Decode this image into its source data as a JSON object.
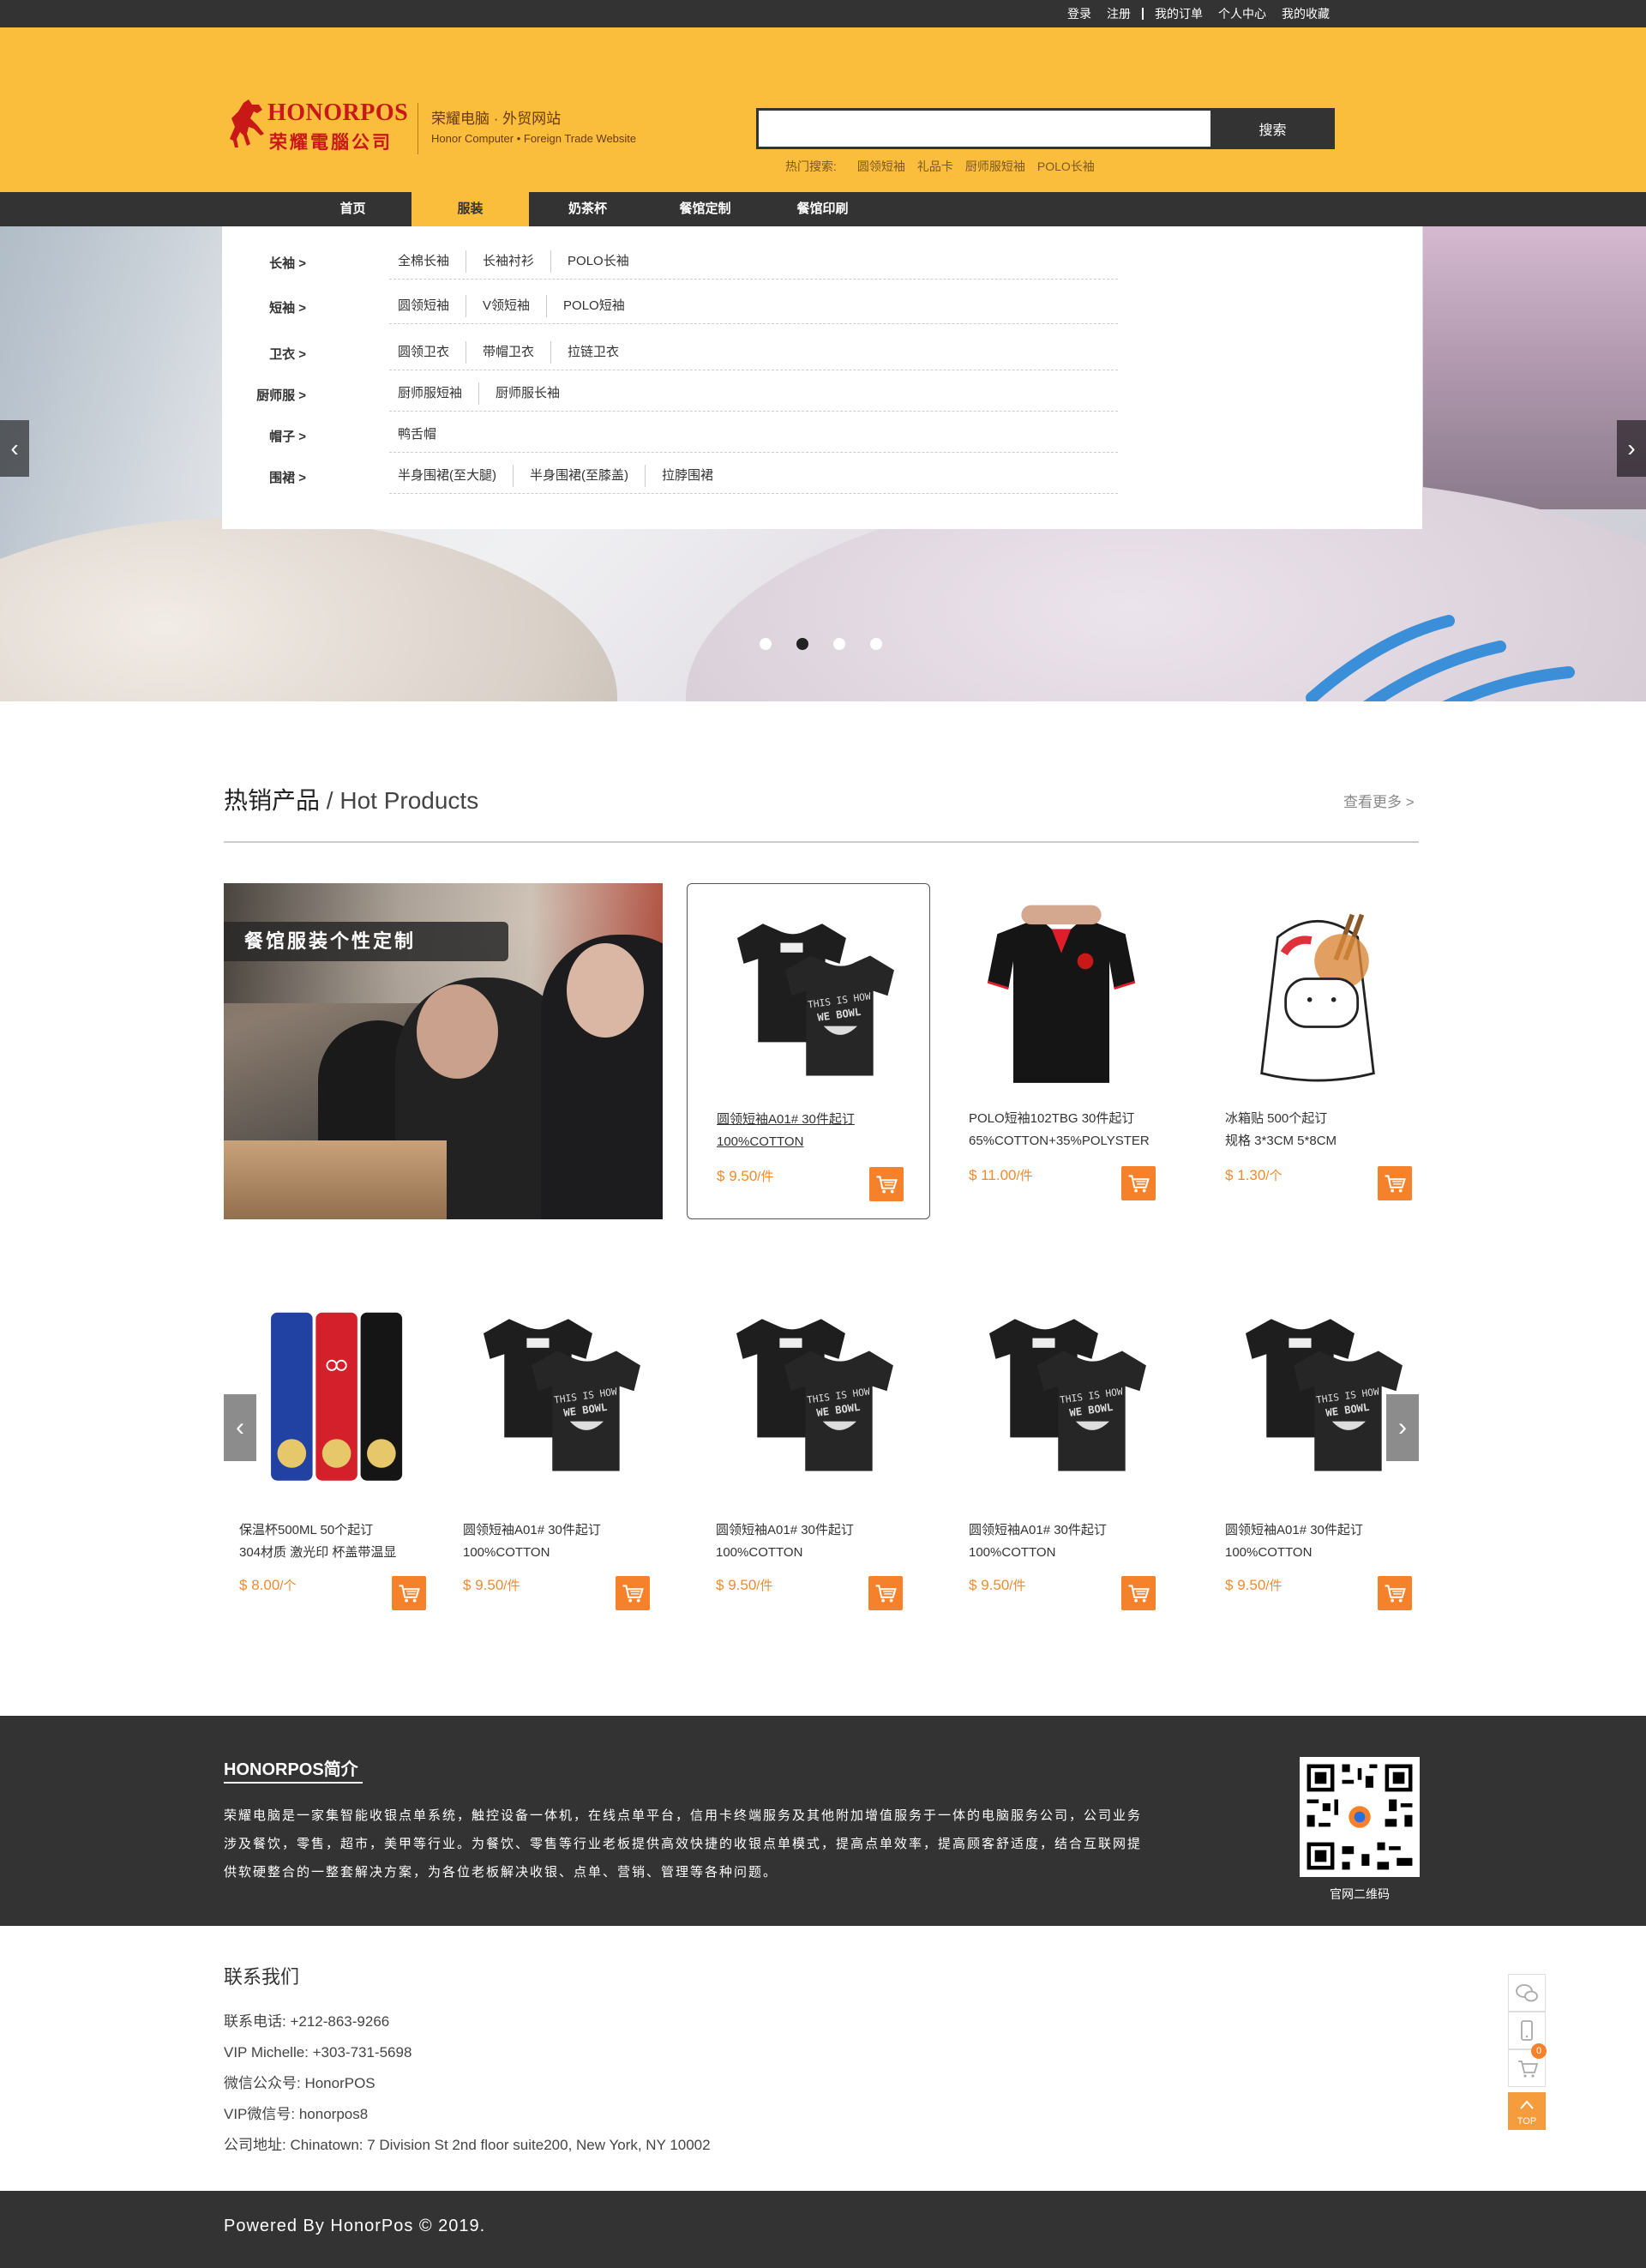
{
  "topbar": {
    "login": "登录",
    "register": "注册",
    "orders": "我的订单",
    "profile": "个人中心",
    "favorites": "我的收藏"
  },
  "header": {
    "logo_en": "HONORPOS",
    "logo_cn": "荣耀電腦公司",
    "site_title": "荣耀电脑 · 外贸网站",
    "site_subtitle": "Honor Computer • Foreign Trade Website",
    "search_placeholder": "",
    "search_button": "搜索",
    "hot_label": "热门搜索:",
    "hot_terms": [
      "圆领短袖",
      "礼品卡",
      "厨师服短袖",
      "POLO长袖"
    ]
  },
  "nav": {
    "items": [
      "首页",
      "服装",
      "奶茶杯",
      "餐馆定制",
      "餐馆印刷"
    ],
    "active_index": 1
  },
  "dropdown": [
    {
      "category": "长袖 >",
      "links": [
        "全棉长袖",
        "长袖衬衫",
        "POLO长袖"
      ]
    },
    {
      "category": "短袖 >",
      "links": [
        "圆领短袖",
        "V领短袖",
        "POLO短袖"
      ]
    },
    {
      "category": "卫衣 >",
      "links": [
        "圆领卫衣",
        "带帽卫衣",
        "拉链卫衣"
      ]
    },
    {
      "category": "厨师服 >",
      "links": [
        "厨师服短袖",
        "厨师服长袖"
      ]
    },
    {
      "category": "帽子 >",
      "links": [
        "鸭舌帽"
      ]
    },
    {
      "category": "围裙 >",
      "links": [
        "半身围裙(至大腿)",
        "半身围裙(至膝盖)",
        "拉脖围裙"
      ]
    }
  ],
  "banner": {
    "arrow_left": "‹",
    "arrow_right": "›",
    "dots": 4,
    "active_dot": 1
  },
  "hot_products": {
    "title_cn": "热销产品",
    "title_sep": " / ",
    "title_en": "Hot Products",
    "more": "查看更多 >",
    "feature_label": "餐馆服装个性定制",
    "row1": [
      {
        "name1": "圆领短袖A01#  30件起订",
        "name2": "100%COTTON",
        "currency": "$",
        "price": "9.50",
        "unit": "/件",
        "image": "tshirt"
      },
      {
        "name1": "POLO短袖102TBG  30件起订",
        "name2": "65%COTTON+35%POLYSTER",
        "currency": "$",
        "price": "11.00",
        "unit": "/件",
        "image": "polo"
      },
      {
        "name1": "冰箱贴 500个起订",
        "name2": "规格 3*3CM 5*8CM",
        "currency": "$",
        "price": "1.30",
        "unit": "/个",
        "image": "magnet"
      }
    ],
    "row2": [
      {
        "name1": "保温杯500ML  50个起订",
        "name2": "304材质 激光印 杯盖带温显",
        "currency": "$",
        "price": "8.00",
        "unit": "/个",
        "image": "bottles"
      },
      {
        "name1": "圆领短袖A01#  30件起订",
        "name2": "100%COTTON",
        "currency": "$",
        "price": "9.50",
        "unit": "/件",
        "image": "tshirt"
      },
      {
        "name1": "圆领短袖A01#  30件起订",
        "name2": "100%COTTON",
        "currency": "$",
        "price": "9.50",
        "unit": "/件",
        "image": "tshirt"
      },
      {
        "name1": "圆领短袖A01#  30件起订",
        "name2": "100%COTTON",
        "currency": "$",
        "price": "9.50",
        "unit": "/件",
        "image": "tshirt"
      },
      {
        "name1": "圆领短袖A01#  30件起订",
        "name2": "100%COTTON",
        "currency": "$",
        "price": "9.50",
        "unit": "/件",
        "image": "tshirt"
      }
    ],
    "carousel_left": "‹",
    "carousel_right": "›"
  },
  "about": {
    "title": "HONORPOS简介",
    "text": "荣耀电脑是一家集智能收银点单系统，触控设备一体机，在线点单平台，信用卡终端服务及其他附加增值服务于一体的电脑服务公司，公司业务涉及餐饮，零售，超市，美甲等行业。为餐饮、零售等行业老板提供高效快捷的收银点单模式，提高点单效率，提高顾客舒适度，结合互联网提供软硬整合的一整套解决方案，为各位老板解决收银、点单、营销、管理等各种问题。",
    "qr_caption": "官网二维码"
  },
  "contact": {
    "title": "联系我们",
    "lines": [
      "联系电话: +212-863-9266",
      "VIP Michelle: +303-731-5698",
      "微信公众号: HonorPOS",
      "VIP微信号: honorpos8",
      "公司地址: Chinatown: 7 Division St 2nd floor suite200, New York, NY 10002"
    ]
  },
  "sidetools": {
    "icons": [
      "wechat-icon",
      "phone-icon",
      "cart-icon"
    ],
    "cart_count": "0",
    "top_label": "TOP"
  },
  "footer": {
    "text": "Powered By HonorPos © 2019."
  },
  "colors": {
    "header_bg": "#fbbd3c",
    "dark": "#333333",
    "accent_orange": "#f5822a",
    "price_orange": "#f08a2c",
    "logo_red": "#c81818"
  }
}
